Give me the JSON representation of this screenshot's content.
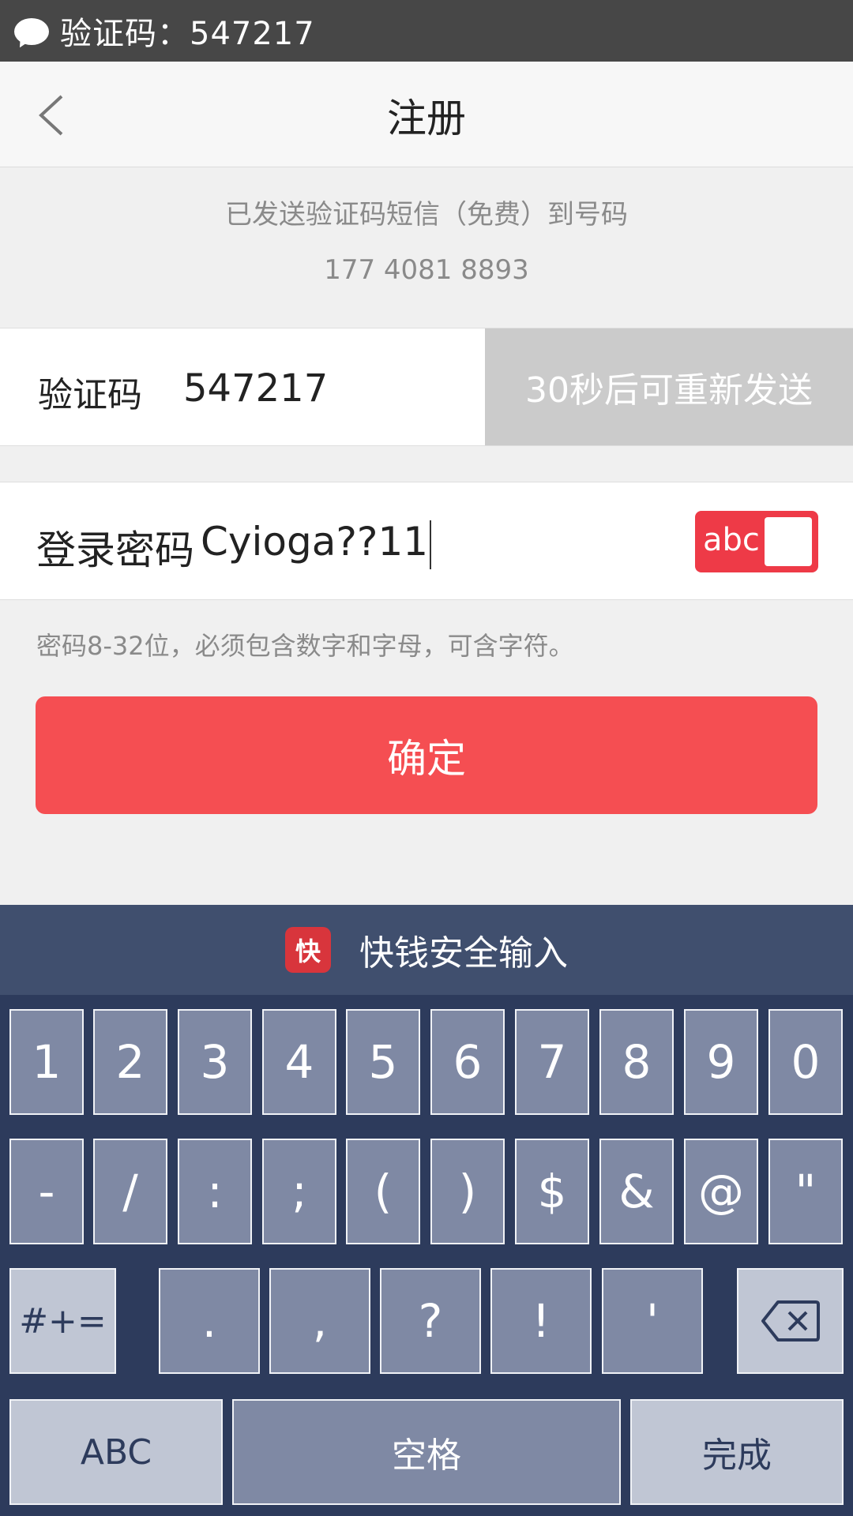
{
  "notification": {
    "text": "验证码：547217"
  },
  "titlebar": {
    "title": "注册"
  },
  "info": {
    "sent_text": "已发送验证码短信（免费）到号码",
    "phone": "177 4081 8893"
  },
  "code_row": {
    "label": "验证码",
    "value": "547217",
    "resend": "30秒后可重新发送"
  },
  "password_row": {
    "label": "登录密码",
    "value": "Cyioga??11",
    "toggle_label": "abc"
  },
  "hint": "密码8-32位，必须包含数字和字母，可含字符。",
  "confirm_label": "确定",
  "keyboard": {
    "title": "快钱安全输入",
    "logo": "快",
    "row1": [
      "1",
      "2",
      "3",
      "4",
      "5",
      "6",
      "7",
      "8",
      "9",
      "0"
    ],
    "row2": [
      "-",
      "/",
      ":",
      ";",
      "(",
      ")",
      "$",
      "&",
      "@",
      "\""
    ],
    "row3": [
      "#+=",
      ".",
      ",",
      "?",
      "!",
      "'"
    ],
    "row4": [
      "ABC",
      "空格",
      "完成"
    ]
  },
  "colors": {
    "accent": "#f54e52",
    "toggle": "#ee3a47",
    "keyboard_bg": "#2d3b5c",
    "key": "#7f89a4"
  }
}
